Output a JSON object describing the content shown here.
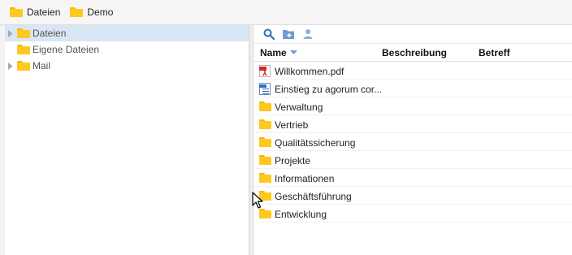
{
  "breadcrumb": [
    {
      "label": "Dateien",
      "icon": "folder-icon"
    },
    {
      "label": "Demo",
      "icon": "folder-icon"
    }
  ],
  "tree": {
    "items": [
      {
        "label": "Dateien",
        "expandable": true,
        "selected": true
      },
      {
        "label": "Eigene Dateien",
        "expandable": false,
        "selected": false
      },
      {
        "label": "Mail",
        "expandable": true,
        "selected": false
      }
    ]
  },
  "toolbar": {
    "icons": [
      "search-icon",
      "new-folder-icon",
      "user-icon"
    ]
  },
  "grid": {
    "columns": {
      "name": "Name",
      "description": "Beschreibung",
      "subject": "Betreff"
    },
    "sort_indicator": "sort-desc-icon",
    "rows": [
      {
        "name": "Willkommen.pdf",
        "type": "pdf-file-icon"
      },
      {
        "name": "Einstieg zu agorum cor...",
        "type": "document-file-icon"
      },
      {
        "name": "Verwaltung",
        "type": "folder-icon"
      },
      {
        "name": "Vertrieb",
        "type": "folder-icon"
      },
      {
        "name": "Qualitätssicherung",
        "type": "folder-icon"
      },
      {
        "name": "Projekte",
        "type": "folder-icon"
      },
      {
        "name": "Informationen",
        "type": "folder-icon"
      },
      {
        "name": "Geschäftsführung",
        "type": "folder-icon"
      },
      {
        "name": "Entwicklung",
        "type": "folder-icon"
      }
    ]
  },
  "colors": {
    "folder": "#ffc81e",
    "selection": "#d9e6f4",
    "toolbar_icon": "#2f6fb3",
    "pdf": "#dd2222"
  }
}
